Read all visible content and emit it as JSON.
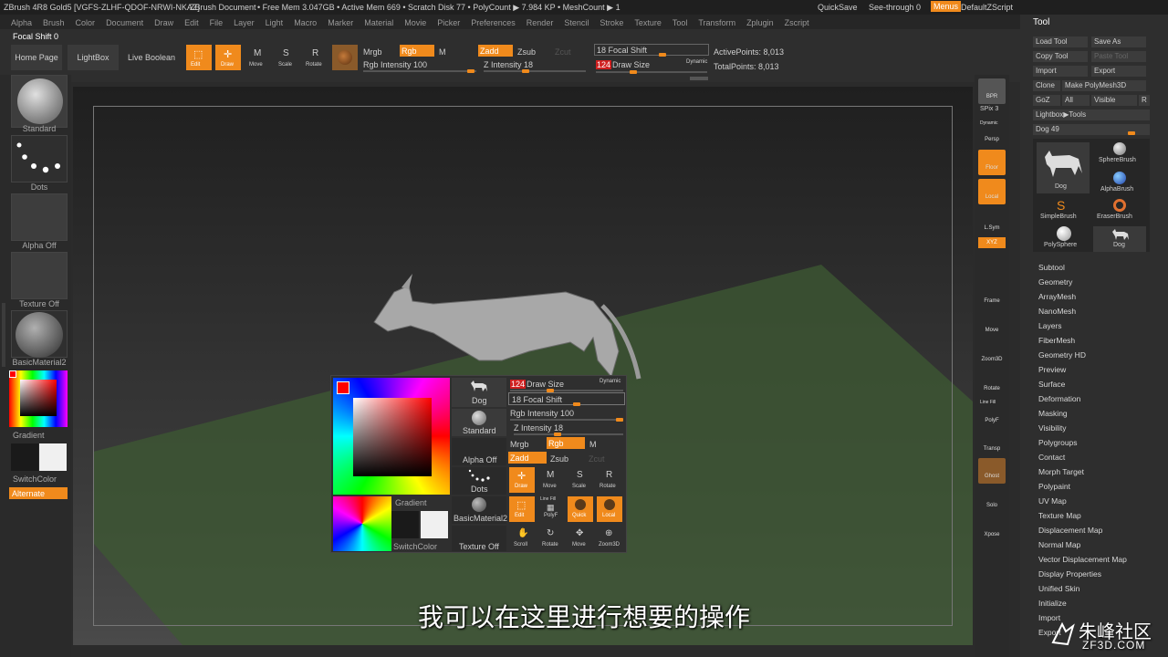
{
  "titlebar": {
    "title": "ZBrush 4R8 Gold5 [VGFS-ZLHF-QDOF-NRWI-NKAZ]",
    "document": "ZBrush Document",
    "stats": "• Free Mem 3.047GB • Active Mem 669 • Scratch Disk 77 • PolyCount ▶ 7.984 KP • MeshCount ▶ 1",
    "quicksave": "QuickSave",
    "seethrough": "See-through 0",
    "menus": "Menus",
    "defaultzscript": "DefaultZScript"
  },
  "menubar": [
    "Alpha",
    "Brush",
    "Color",
    "Document",
    "Draw",
    "Edit",
    "File",
    "Layer",
    "Light",
    "Macro",
    "Marker",
    "Material",
    "Movie",
    "Picker",
    "Preferences",
    "Render",
    "Stencil",
    "Stroke",
    "Texture",
    "Tool",
    "Transform",
    "Zplugin",
    "Zscript"
  ],
  "toolbar": {
    "focal_shift_label": "Focal Shift 0",
    "home_page": "Home Page",
    "lightbox": "LightBox",
    "live_boolean": "Live Boolean",
    "edit": "Edit",
    "draw": "Draw",
    "move": "Move",
    "scale": "Scale",
    "rotate": "Rotate",
    "mrgb": "Mrgb",
    "rgb": "Rgb",
    "m": "M",
    "zadd": "Zadd",
    "zsub": "Zsub",
    "zcut": "Zcut",
    "rgb_intensity": "Rgb Intensity 100",
    "z_intensity": "Z Intensity 18",
    "focal_shift": "18 Focal Shift",
    "draw_size_value": "124",
    "draw_size": "Draw Size",
    "dynamic": "Dynamic",
    "active_points": "ActivePoints: 8,013",
    "total_points": "TotalPoints: 8,013"
  },
  "leftshelf": {
    "standard": "Standard",
    "dots": "Dots",
    "alpha_off": "Alpha Off",
    "texture_off": "Texture Off",
    "material": "BasicMaterial2",
    "gradient": "Gradient",
    "switchcolor": "SwitchColor",
    "alternate": "Alternate"
  },
  "rightshelf": {
    "bpr": "BPR",
    "spix": "SPix 3",
    "dynamic": "Dynamic",
    "persp": "Persp",
    "floor": "Floor",
    "local": "Local",
    "lsym": "L.Sym",
    "xyz": "XYZ",
    "frame": "Frame",
    "move": "Move",
    "zoom3d": "Zoom3D",
    "rotate": "Rotate",
    "linefill": "Line Fill",
    "polyf": "PolyF",
    "transp": "Transp",
    "ghost": "Ghost",
    "solo": "Solo",
    "xpose": "Xpose"
  },
  "toolpanel": {
    "title": "Tool",
    "load_tool": "Load Tool",
    "save_as": "Save As",
    "copy_tool": "Copy Tool",
    "paste_tool": "Paste Tool",
    "import": "Import",
    "export": "Export",
    "clone": "Clone",
    "make_polymesh": "Make PolyMesh3D",
    "goz": "GoZ",
    "all": "All",
    "visible": "Visible",
    "r": "R",
    "lightbox_tools": "Lightbox▶Tools",
    "dog_slider": "Dog  49",
    "tools": [
      "Dog",
      "SphereBrush",
      "AlphaBrush",
      "SimpleBrush",
      "EraserBrush",
      "PolySphere",
      "Dog"
    ],
    "menu": [
      "Subtool",
      "Geometry",
      "ArrayMesh",
      "NanoMesh",
      "Layers",
      "FiberMesh",
      "Geometry HD",
      "Preview",
      "Surface",
      "Deformation",
      "Masking",
      "Visibility",
      "Polygroups",
      "Contact",
      "Morph Target",
      "Polypaint",
      "UV Map",
      "Texture Map",
      "Displacement Map",
      "Normal Map",
      "Vector Displacement Map",
      "Display Properties",
      "Unified Skin",
      "Initialize",
      "Import",
      "Export"
    ]
  },
  "popup": {
    "dog": "Dog",
    "standard": "Standard",
    "alpha_off": "Alpha Off",
    "dots": "Dots",
    "material": "BasicMaterial2",
    "texture_off": "Texture Off",
    "gradient": "Gradient",
    "switchcolor": "SwitchColor",
    "draw_size_value": "124",
    "draw_size": "Draw Size",
    "dynamic": "Dynamic",
    "focal_shift": "18 Focal Shift",
    "rgb_intensity": "Rgb Intensity 100",
    "z_intensity": "Z Intensity 18",
    "mrgb": "Mrgb",
    "rgb": "Rgb",
    "m": "M",
    "zadd": "Zadd",
    "zsub": "Zsub",
    "zcut": "Zcut",
    "draw": "Draw",
    "move": "Move",
    "scale": "Scale",
    "rotate": "Rotate",
    "edit": "Edit",
    "polyf": "PolyF",
    "linefill": "Line Fill",
    "quick": "Quick",
    "local": "Local",
    "scroll": "Scroll",
    "rotate2": "Rotate",
    "move2": "Move",
    "zoom3d": "Zoom3D"
  },
  "subtitle": "我可以在这里进行想要的操作",
  "watermark": {
    "brand": "朱峰社区",
    "url": "ZF3D.COM"
  },
  "colors": {
    "accent": "#f08a1c",
    "panel": "#2e2e2e",
    "floor": "#3d5a33",
    "active_color": "#ff0000"
  }
}
